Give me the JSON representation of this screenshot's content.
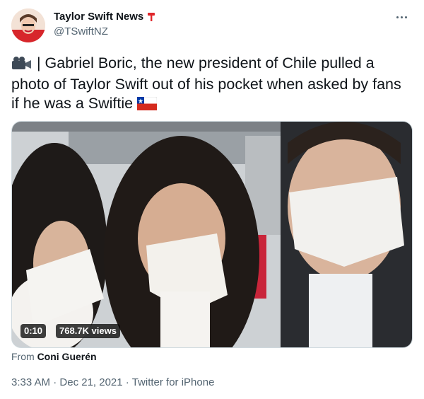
{
  "user": {
    "display_name": "Taylor Swift News",
    "handle": "@TSwiftNZ",
    "avatar_icon": "avatar-profile-photo",
    "name_badge_icon": "microphone-icon"
  },
  "tweet": {
    "leading_emoji": "video-camera-icon",
    "text_prefix": " | ",
    "text": "Gabriel Boric, the new president of Chile pulled a photo of Taylor Swift out of his pocket when asked by fans if he was a Swiftie",
    "trailing_emoji": "chile-flag-icon"
  },
  "media": {
    "duration": "0:10",
    "views": "768.7K views"
  },
  "attribution": {
    "prefix": "From",
    "source": "Coni Guerén"
  },
  "meta": {
    "time": "3:33 AM",
    "separator": " · ",
    "date": "Dec 21, 2021",
    "client": "Twitter for iPhone"
  },
  "colors": {
    "text_primary": "#0f1419",
    "text_secondary": "#536471",
    "badge_red": "#e0262b"
  }
}
